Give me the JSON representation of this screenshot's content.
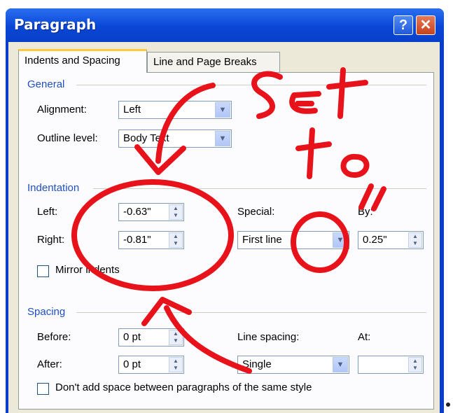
{
  "window": {
    "title": "Paragraph",
    "help_glyph": "?",
    "close_glyph": "✕"
  },
  "tabs": [
    {
      "label": "Indents and Spacing"
    },
    {
      "label": "Line and Page Breaks"
    }
  ],
  "general": {
    "heading": "General",
    "alignment_label": "Alignment:",
    "alignment_value": "Left",
    "outline_label": "Outline level:",
    "outline_value": "Body Text"
  },
  "indentation": {
    "heading": "Indentation",
    "left_label": "Left:",
    "left_value": "-0.63\"",
    "right_label": "Right:",
    "right_value": "-0.81\"",
    "special_label": "Special:",
    "special_value": "First line",
    "by_label": "By:",
    "by_value": "0.25\"",
    "mirror_label": "Mirror indents"
  },
  "spacing": {
    "heading": "Spacing",
    "before_label": "Before:",
    "before_value": "0 pt",
    "after_label": "After:",
    "after_value": "0 pt",
    "line_spacing_label": "Line spacing:",
    "line_spacing_value": "Single",
    "at_label": "At:",
    "at_value": "",
    "dont_add_label": "Don't add space between paragraphs of the same style"
  },
  "annotation": {
    "line1": "Set",
    "line2": "to",
    "line3": "0",
    "color": "#e8121b"
  }
}
